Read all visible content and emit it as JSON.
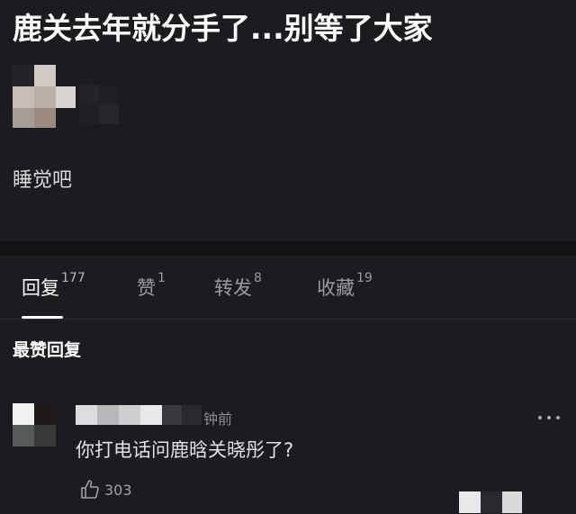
{
  "post": {
    "title": "鹿关去年就分手了...别等了大家",
    "body": "睡觉吧"
  },
  "tabs": [
    {
      "label": "回复",
      "count": "177"
    },
    {
      "label": "赞",
      "count": "1"
    },
    {
      "label": "转发",
      "count": "8"
    },
    {
      "label": "收藏",
      "count": "19"
    }
  ],
  "section_title": "最赞回复",
  "comment": {
    "time": "钟前",
    "text": "你打电话问鹿晗关晓彤了?",
    "likes": "303"
  },
  "icons": {
    "like": "thumbs-up-icon",
    "more": "more-dots-icon"
  },
  "colors": {
    "background": "#1c1c20",
    "band": "#121215",
    "active_tab": "#ffffff",
    "inactive_tab": "#9a9aa0"
  }
}
